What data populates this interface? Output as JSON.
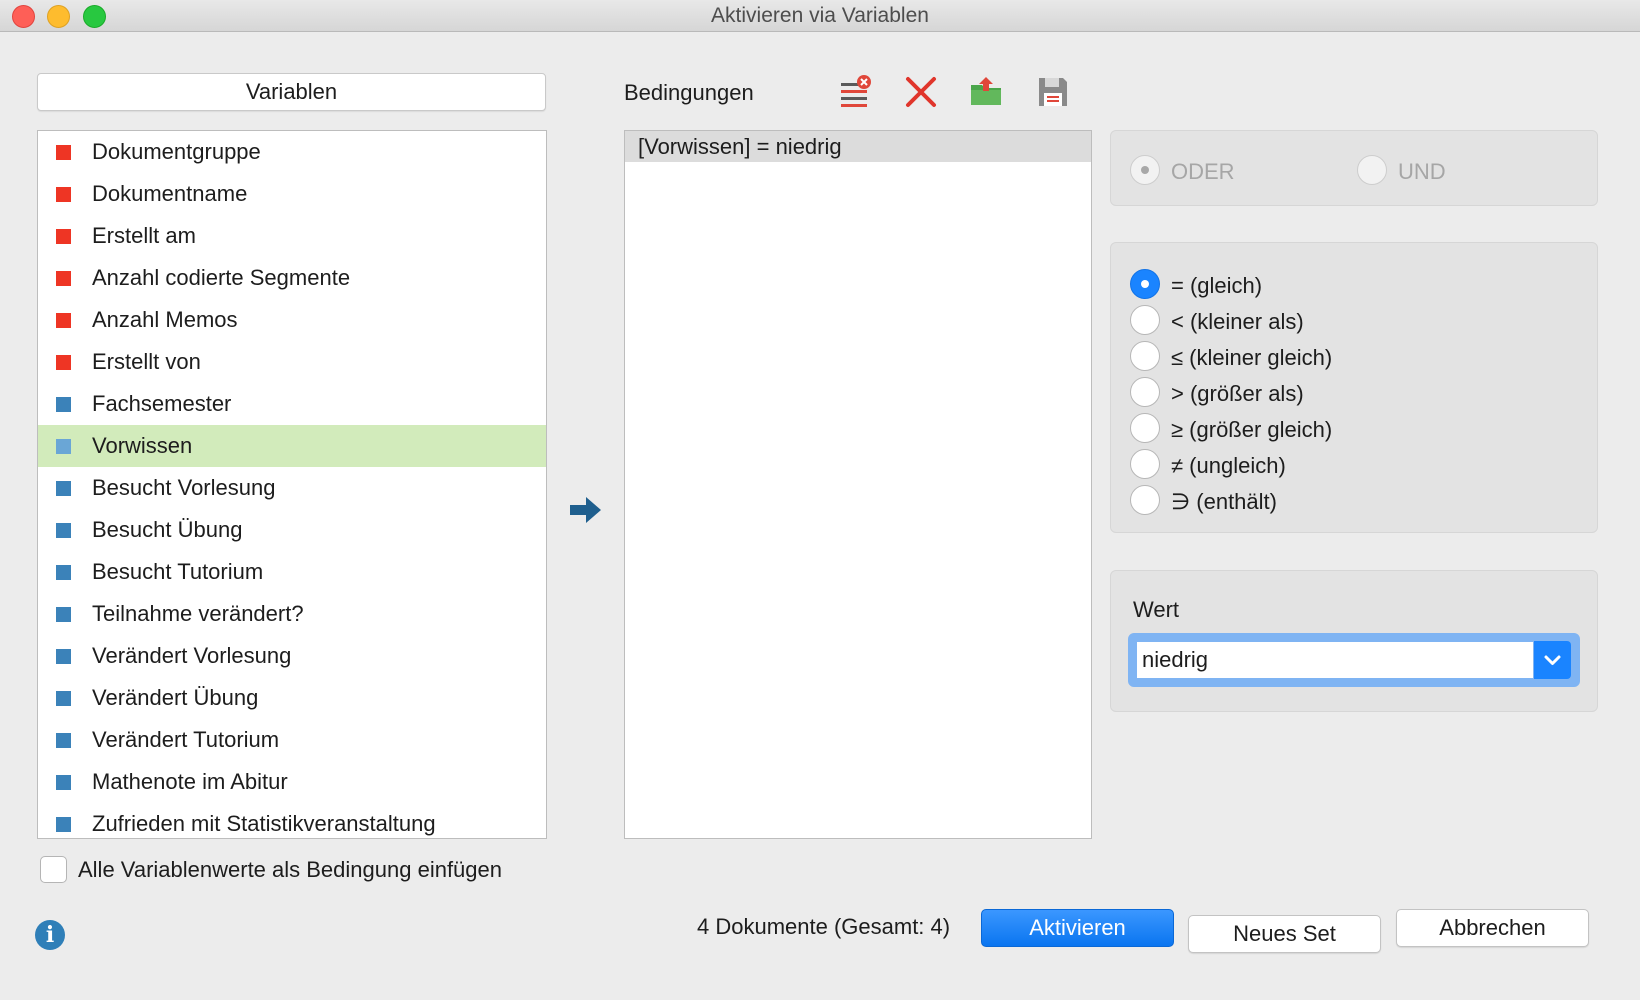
{
  "window": {
    "title": "Aktivieren via Variablen"
  },
  "variables": {
    "header": "Variablen",
    "items": [
      {
        "label": "Dokumentgruppe",
        "color": "#ee3524"
      },
      {
        "label": "Dokumentname",
        "color": "#ee3524"
      },
      {
        "label": "Erstellt am",
        "color": "#ee3524"
      },
      {
        "label": "Anzahl codierte Segmente",
        "color": "#ee3524"
      },
      {
        "label": "Anzahl Memos",
        "color": "#ee3524"
      },
      {
        "label": "Erstellt von",
        "color": "#ee3524"
      },
      {
        "label": "Fachsemester",
        "color": "#3b82b9"
      },
      {
        "label": "Vorwissen",
        "color": "#6aa6d6",
        "selected": true
      },
      {
        "label": "Besucht Vorlesung",
        "color": "#3b82b9"
      },
      {
        "label": "Besucht Übung",
        "color": "#3b82b9"
      },
      {
        "label": "Besucht Tutorium",
        "color": "#3b82b9"
      },
      {
        "label": "Teilnahme verändert?",
        "color": "#3b82b9"
      },
      {
        "label": "Verändert Vorlesung",
        "color": "#3b82b9"
      },
      {
        "label": "Verändert Übung",
        "color": "#3b82b9"
      },
      {
        "label": "Verändert Tutorium",
        "color": "#3b82b9"
      },
      {
        "label": "Mathenote im Abitur",
        "color": "#3b82b9"
      },
      {
        "label": "Zufrieden mit Statistikveranstaltung",
        "color": "#3b82b9"
      }
    ],
    "checkbox_label": "Alle Variablenwerte als Bedingung einfügen"
  },
  "conditions": {
    "label": "Bedingungen",
    "items": [
      "[Vorwissen] = niedrig"
    ]
  },
  "logic": {
    "or_label": "ODER",
    "and_label": "UND",
    "selected": "ODER"
  },
  "operators": {
    "options": [
      "= (gleich)",
      "< (kleiner als)",
      "≤ (kleiner gleich)",
      "> (größer als)",
      "≥ (größer gleich)",
      "≠ (ungleich)",
      "∋ (enthält)"
    ],
    "selected": "= (gleich)"
  },
  "value": {
    "label": "Wert",
    "current": "niedrig"
  },
  "footer": {
    "count_text": "4 Dokumente (Gesamt: 4)",
    "activate_label": "Aktivieren",
    "new_set_label": "Neues Set",
    "cancel_label": "Abbrechen"
  }
}
